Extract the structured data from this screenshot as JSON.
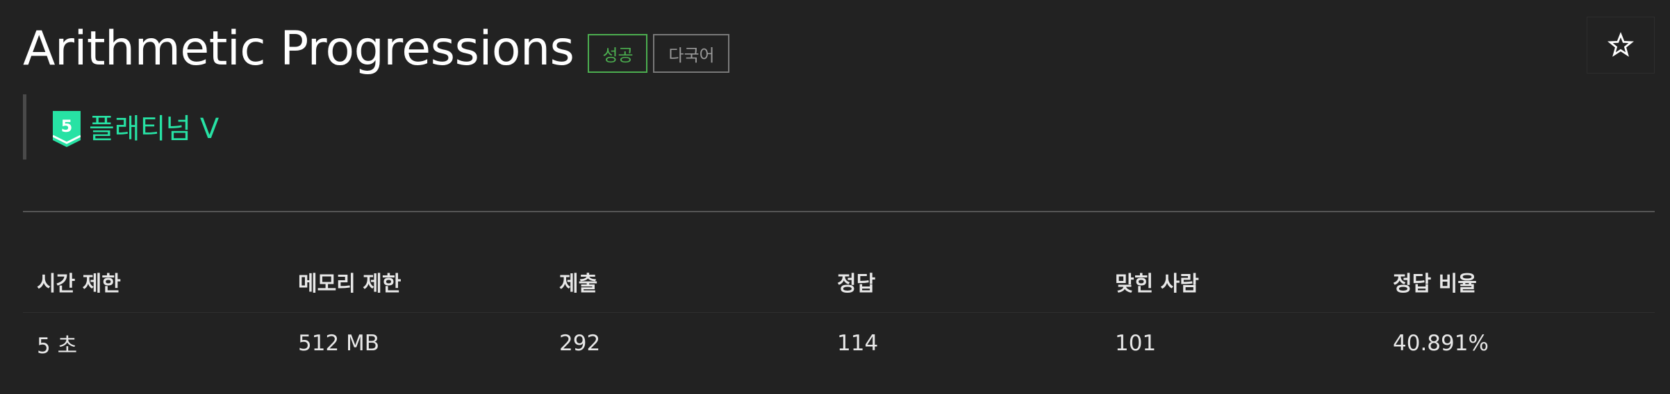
{
  "problem": {
    "title": "Arithmetic Progressions",
    "tags": {
      "success": "성공",
      "multilang": "다국어"
    },
    "tier": {
      "level": "5",
      "name": "플래티넘 V",
      "color": "#27e2a4"
    },
    "star_icon": "☆"
  },
  "colors": {
    "background": "#222222",
    "success": "#4caf50",
    "tier": "#27e2a4"
  },
  "stats": {
    "headers": [
      "시간 제한",
      "메모리 제한",
      "제출",
      "정답",
      "맞힌 사람",
      "정답 비율"
    ],
    "values": [
      "5 초",
      "512 MB",
      "292",
      "114",
      "101",
      "40.891%"
    ]
  }
}
